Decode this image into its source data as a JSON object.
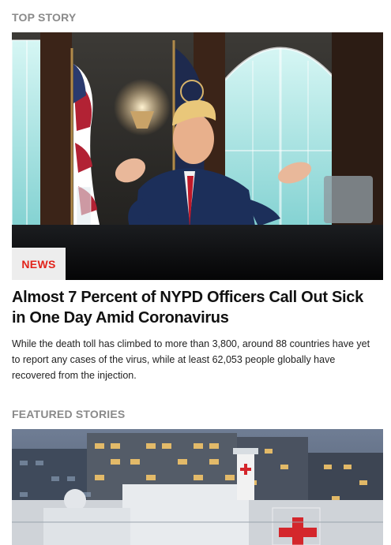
{
  "top_story": {
    "section_label": "TOP STORY",
    "category": "NEWS",
    "headline": "Almost 7 Percent of NYPD Officers Call Out Sick in One Day Amid Coronavirus",
    "summary": "While the death toll has climbed to more than 3,800, around 88 countries have yet to report any cases of the virus, while at least 62,053 people globally have recovered from the injection.",
    "image_icon": "news-photo"
  },
  "featured": {
    "section_label": "FEATURED STORIES",
    "image_icon": "hospital-ship-photo"
  },
  "colors": {
    "section_label": "#8a8a8a",
    "category_text": "#e2231a",
    "category_bg": "#ededed",
    "headline": "#111111",
    "body_text": "#222222"
  }
}
